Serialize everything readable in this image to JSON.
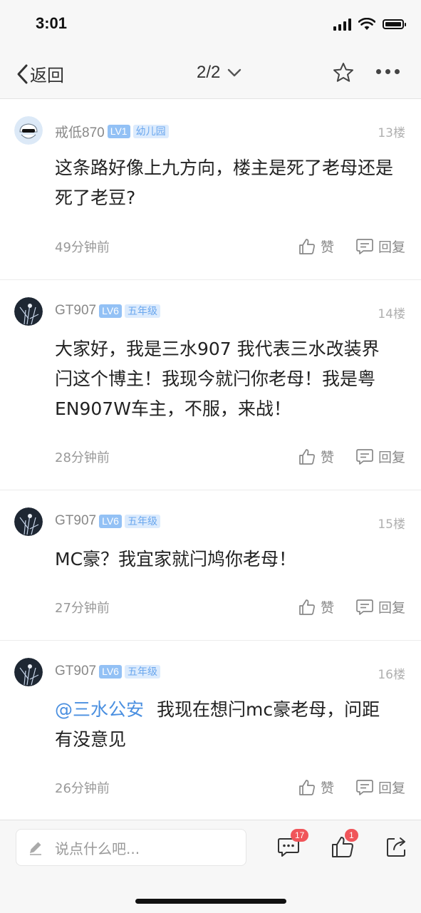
{
  "status": {
    "time": "3:01"
  },
  "nav": {
    "back_label": "返回",
    "page_indicator": "2/2"
  },
  "posts": [
    {
      "username": "戒低870",
      "level": "LV1",
      "rank": "幼儿园",
      "floor": "13楼",
      "mention": "",
      "content": "这条路好像上九方向，楼主是死了老母还是死了老豆?",
      "time": "49分钟前",
      "like_label": "赞",
      "reply_label": "回复"
    },
    {
      "username": "GT907",
      "level": "LV6",
      "rank": "五年级",
      "floor": "14楼",
      "mention": "",
      "content": "大家好，我是三水907  我代表三水改装界闩这个博主！我现今就闩你老母！我是粤EN907W车主，不服，来战！",
      "time": "28分钟前",
      "like_label": "赞",
      "reply_label": "回复"
    },
    {
      "username": "GT907",
      "level": "LV6",
      "rank": "五年级",
      "floor": "15楼",
      "mention": "",
      "content": "MC豪？我宜家就闩鸠你老母！",
      "time": "27分钟前",
      "like_label": "赞",
      "reply_label": "回复"
    },
    {
      "username": "GT907",
      "level": "LV6",
      "rank": "五年级",
      "floor": "16楼",
      "mention": "@三水公安",
      "content": "我现在想闩mc豪老母，问距有没意见",
      "time": "26分钟前",
      "like_label": "赞",
      "reply_label": "回复"
    }
  ],
  "bottom": {
    "comment_placeholder": "说点什么吧...",
    "comment_count": "17",
    "like_count": "1"
  },
  "colors": {
    "accent": "#4a8fe0",
    "badge": "#93c1f5",
    "notification": "#f0555a"
  },
  "icons": [
    "back-chevron-icon",
    "chevron-down-icon",
    "star-icon",
    "more-icon",
    "thumbs-up-icon",
    "reply-bubble-icon",
    "pencil-icon",
    "comment-icon",
    "share-icon"
  ]
}
